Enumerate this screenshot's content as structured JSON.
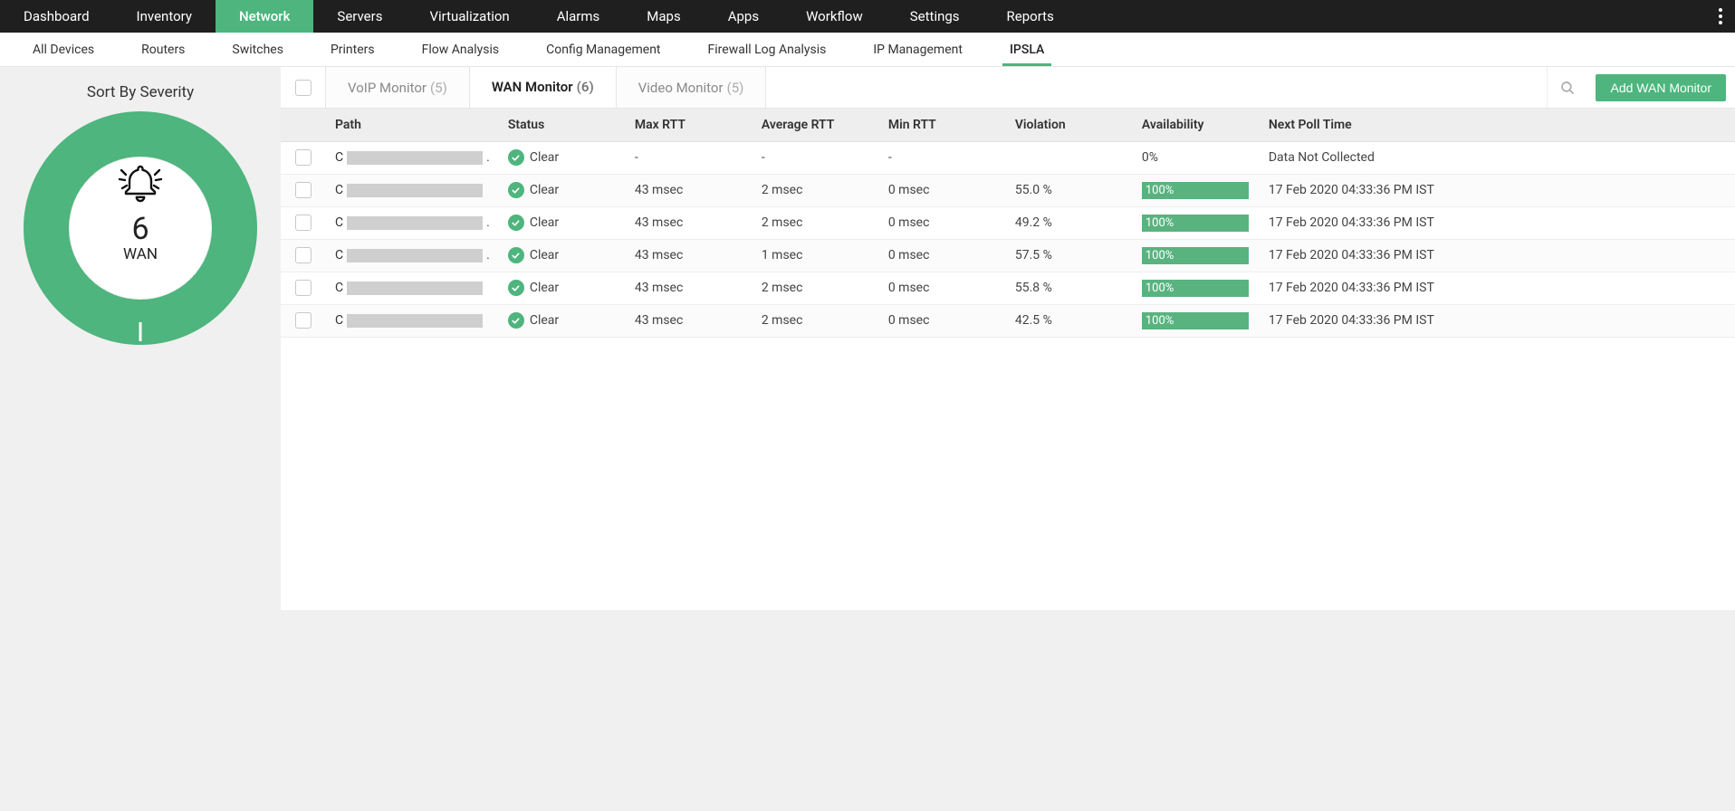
{
  "colors": {
    "accent": "#4db57d"
  },
  "nav": {
    "primary": [
      {
        "label": "Dashboard",
        "active": false
      },
      {
        "label": "Inventory",
        "active": false
      },
      {
        "label": "Network",
        "active": true
      },
      {
        "label": "Servers",
        "active": false
      },
      {
        "label": "Virtualization",
        "active": false
      },
      {
        "label": "Alarms",
        "active": false
      },
      {
        "label": "Maps",
        "active": false
      },
      {
        "label": "Apps",
        "active": false
      },
      {
        "label": "Workflow",
        "active": false
      },
      {
        "label": "Settings",
        "active": false
      },
      {
        "label": "Reports",
        "active": false
      }
    ],
    "secondary": [
      {
        "label": "All Devices",
        "active": false
      },
      {
        "label": "Routers",
        "active": false
      },
      {
        "label": "Switches",
        "active": false
      },
      {
        "label": "Printers",
        "active": false
      },
      {
        "label": "Flow Analysis",
        "active": false
      },
      {
        "label": "Config Management",
        "active": false
      },
      {
        "label": "Firewall Log Analysis",
        "active": false
      },
      {
        "label": "IP Management",
        "active": false
      },
      {
        "label": "IPSLA",
        "active": true
      }
    ]
  },
  "severity": {
    "title": "Sort By Severity",
    "count": "6",
    "label": "WAN",
    "clear_fraction": 1.0
  },
  "tabs": [
    {
      "label": "VoIP Monitor",
      "count": "(5)",
      "active": false
    },
    {
      "label": "WAN Monitor",
      "count": "(6)",
      "active": true
    },
    {
      "label": "Video Monitor",
      "count": "(5)",
      "active": false
    }
  ],
  "action_button": "Add WAN Monitor",
  "table": {
    "columns": [
      "Path",
      "Status",
      "Max RTT",
      "Average RTT",
      "Min RTT",
      "Violation",
      "Availability",
      "Next Poll Time"
    ],
    "rows": [
      {
        "path_prefix": "C",
        "path_suffix": ".",
        "status": "Clear",
        "max_rtt": "-",
        "avg_rtt": "-",
        "min_rtt": "-",
        "violation": "",
        "availability": "0%",
        "avail_bar": false,
        "next_poll": "Data Not Collected"
      },
      {
        "path_prefix": "C",
        "path_suffix": "",
        "status": "Clear",
        "max_rtt": "43 msec",
        "avg_rtt": "2 msec",
        "min_rtt": "0 msec",
        "violation": "55.0 %",
        "availability": "100%",
        "avail_bar": true,
        "next_poll": "17 Feb 2020 04:33:36 PM IST"
      },
      {
        "path_prefix": "C",
        "path_suffix": ".",
        "status": "Clear",
        "max_rtt": "43 msec",
        "avg_rtt": "2 msec",
        "min_rtt": "0 msec",
        "violation": "49.2 %",
        "availability": "100%",
        "avail_bar": true,
        "next_poll": "17 Feb 2020 04:33:36 PM IST"
      },
      {
        "path_prefix": "C",
        "path_suffix": ".",
        "status": "Clear",
        "max_rtt": "43 msec",
        "avg_rtt": "1 msec",
        "min_rtt": "0 msec",
        "violation": "57.5 %",
        "availability": "100%",
        "avail_bar": true,
        "next_poll": "17 Feb 2020 04:33:36 PM IST"
      },
      {
        "path_prefix": "C",
        "path_suffix": "",
        "status": "Clear",
        "max_rtt": "43 msec",
        "avg_rtt": "2 msec",
        "min_rtt": "0 msec",
        "violation": "55.8 %",
        "availability": "100%",
        "avail_bar": true,
        "next_poll": "17 Feb 2020 04:33:36 PM IST"
      },
      {
        "path_prefix": "C",
        "path_suffix": "",
        "status": "Clear",
        "max_rtt": "43 msec",
        "avg_rtt": "2 msec",
        "min_rtt": "0 msec",
        "violation": "42.5 %",
        "availability": "100%",
        "avail_bar": true,
        "next_poll": "17 Feb 2020 04:33:36 PM IST"
      }
    ]
  },
  "chart_data": {
    "type": "pie",
    "title": "Sort By Severity",
    "series": [
      {
        "name": "Clear",
        "value": 6,
        "color": "#4db57d"
      }
    ],
    "center_label_value": 6,
    "center_label_text": "WAN"
  }
}
